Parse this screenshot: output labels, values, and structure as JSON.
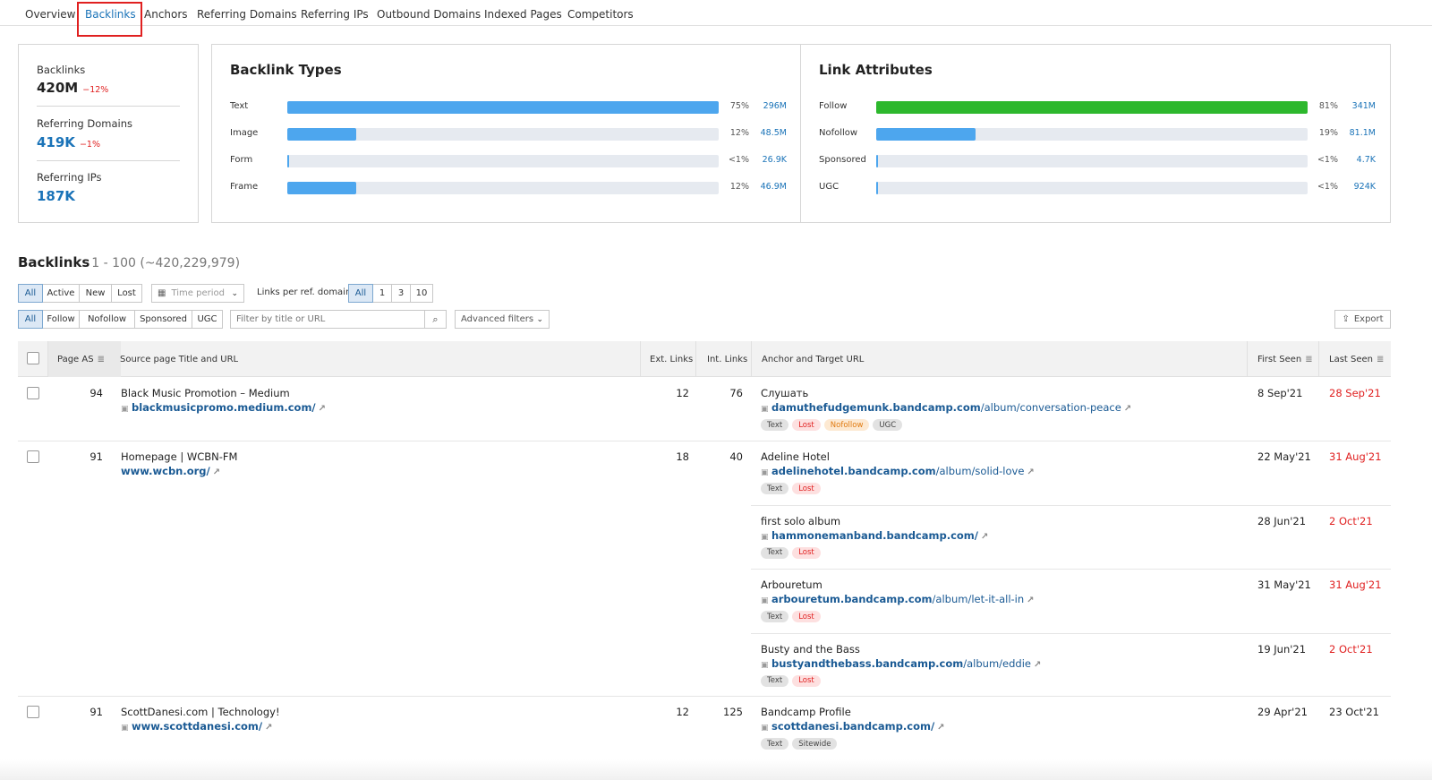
{
  "tabs": [
    "Overview",
    "Backlinks",
    "Anchors",
    "Referring Domains",
    "Referring IPs",
    "Outbound Domains",
    "Indexed Pages",
    "Competitors"
  ],
  "summary": {
    "backlinks": {
      "label": "Backlinks",
      "value": "420M",
      "change": "−12%"
    },
    "ref_domains": {
      "label": "Referring Domains",
      "value": "419K",
      "change": "−1%"
    },
    "ref_ips": {
      "label": "Referring IPs",
      "value": "187K"
    }
  },
  "backlink_types": {
    "title": "Backlink Types",
    "rows": [
      {
        "label": "Text",
        "pct": "75%",
        "count": "296M",
        "fill": 1.0
      },
      {
        "label": "Image",
        "pct": "12%",
        "count": "48.5M",
        "fill": 0.16
      },
      {
        "label": "Form",
        "pct": "<1%",
        "count": "26.9K",
        "fill": 0.004
      },
      {
        "label": "Frame",
        "pct": "12%",
        "count": "46.9M",
        "fill": 0.16
      }
    ]
  },
  "link_attributes": {
    "title": "Link Attributes",
    "rows": [
      {
        "label": "Follow",
        "pct": "81%",
        "count": "341M",
        "fill": 1.0
      },
      {
        "label": "Nofollow",
        "pct": "19%",
        "count": "81.1M",
        "fill": 0.23
      },
      {
        "label": "Sponsored",
        "pct": "<1%",
        "count": "4.7K",
        "fill": 0.004
      },
      {
        "label": "UGC",
        "pct": "<1%",
        "count": "924K",
        "fill": 0.004
      }
    ]
  },
  "section": {
    "title": "Backlinks",
    "range": "1 - 100 (~420,229,979)"
  },
  "filters": {
    "status": [
      "All",
      "Active",
      "New",
      "Lost"
    ],
    "time_period": "Time period",
    "links_per_label": "Links per ref. domain",
    "links_per": [
      "All",
      "1",
      "3",
      "10"
    ],
    "attrs": [
      "All",
      "Follow",
      "Nofollow",
      "Sponsored",
      "UGC"
    ],
    "search_placeholder": "Filter by title or URL",
    "advanced": "Advanced filters",
    "export": "Export"
  },
  "columns": [
    "Page AS",
    "Source page Title and URL",
    "Ext. Links",
    "Int. Links",
    "Anchor and Target URL",
    "First Seen",
    "Last Seen"
  ],
  "rows": [
    {
      "as": "94",
      "title": "Black Music Promotion – Medium",
      "url": "blackmusicpromo.medium.com/",
      "ext": "12",
      "int": "76",
      "anchors": [
        {
          "anchor": "Слушать",
          "domain": "damuthefudgemunk.bandcamp.com",
          "path": "/album/conversation-peace",
          "tags": [
            "Text",
            "Lost",
            "Nofollow",
            "UGC"
          ],
          "first": "8 Sep'21",
          "last": "28 Sep'21"
        }
      ]
    },
    {
      "as": "91",
      "title": "Homepage | WCBN-FM",
      "url": "www.wcbn.org/",
      "ext": "18",
      "int": "40",
      "anchors": [
        {
          "anchor": "Adeline Hotel",
          "domain": "adelinehotel.bandcamp.com",
          "path": "/album/solid-love",
          "tags": [
            "Text",
            "Lost"
          ],
          "first": "22 May'21",
          "last": "31 Aug'21"
        },
        {
          "anchor": "first solo album",
          "domain": "hammonemanband.bandcamp.com/",
          "path": "",
          "tags": [
            "Text",
            "Lost"
          ],
          "first": "28 Jun'21",
          "last": "2 Oct'21"
        },
        {
          "anchor": "Arbouretum",
          "domain": "arbouretum.bandcamp.com",
          "path": "/album/let-it-all-in",
          "tags": [
            "Text",
            "Lost"
          ],
          "first": "31 May'21",
          "last": "31 Aug'21"
        },
        {
          "anchor": "Busty and the Bass",
          "domain": "bustyandthebass.bandcamp.com",
          "path": "/album/eddie",
          "tags": [
            "Text",
            "Lost"
          ],
          "first": "19 Jun'21",
          "last": "2 Oct'21"
        }
      ]
    },
    {
      "as": "91",
      "title": "ScottDanesi.com | Technology!",
      "url": "www.scottdanesi.com/",
      "ext": "12",
      "int": "125",
      "anchors": [
        {
          "anchor": "Bandcamp Profile",
          "domain": "scottdanesi.bandcamp.com/",
          "path": "",
          "tags": [
            "Text",
            "Sitewide"
          ],
          "first": "29 Apr'21",
          "last": "23 Oct'21"
        }
      ]
    }
  ],
  "colors": {
    "accent": "#1a73b8",
    "bar_blue": "#4da6ee",
    "bar_green": "#2db82d",
    "red": "#e02020"
  },
  "icons": [
    "calendar-icon",
    "chevron-down-icon",
    "search-icon",
    "export-icon",
    "sort-icon",
    "lock-icon",
    "external-link-icon"
  ]
}
